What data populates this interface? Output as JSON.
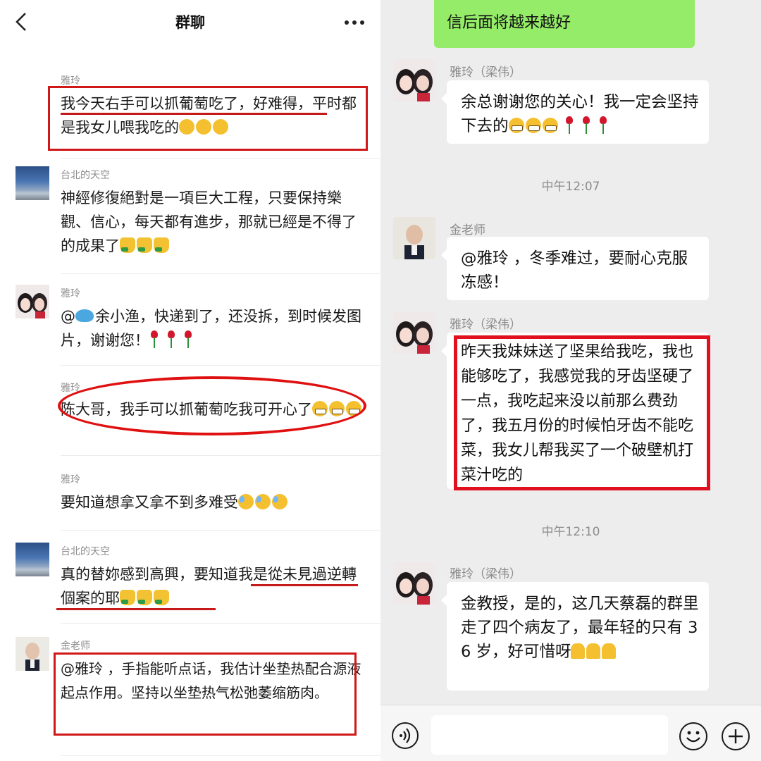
{
  "left_panel": {
    "header": {
      "title": "群聊"
    },
    "posts": [
      {
        "author": "雅玲",
        "text": "我今天右手可以抓葡萄吃了，好难得，平时都是我女儿喂我吃的",
        "emojis": [
          "cover-face",
          "cover-face",
          "cover-face"
        ]
      },
      {
        "author": "台北的天空",
        "text": "神經修復絕對是一項巨大工程，只要保持樂觀、信心，每天都有進步，那就已經是不得了的成果了",
        "emojis": [
          "thumbs-up",
          "thumbs-up",
          "thumbs-up"
        ]
      },
      {
        "author": "雅玲",
        "mention": "@",
        "mention_name": "余小渔",
        "text": "，快递到了，还没拆，到时候发图片，谢谢您！",
        "emojis": [
          "rose",
          "rose",
          "rose"
        ]
      },
      {
        "author": "雅玲",
        "text": "陈大哥，我手可以抓葡萄吃我可开心了",
        "emojis": [
          "grin",
          "grin",
          "grin"
        ]
      },
      {
        "author": "雅玲",
        "text": "要知道想拿又拿不到多难受",
        "emojis": [
          "sweat",
          "sweat",
          "sweat"
        ]
      },
      {
        "author": "台北的天空",
        "text": "真的替妳感到高興，要知道我是從未見過逆轉個案的耶",
        "emojis": [
          "thumbs-up",
          "thumbs-up",
          "thumbs-up"
        ]
      },
      {
        "author": "金老师",
        "text": "@雅玲 ，手指能听点话，我估计坐垫热配合源液起点作用。坚持以坐垫热气松弛萎缩筋肉。",
        "emojis": []
      }
    ]
  },
  "right_panel": {
    "top_green_bubble": {
      "text": "信后面将越来越好"
    },
    "messages": [
      {
        "sender": "雅玲（梁伟）",
        "text": "余总谢谢您的关心！我一定会坚持下去的",
        "emojis": [
          "grin",
          "grin",
          "grin",
          "rose",
          "rose",
          "rose"
        ]
      },
      {
        "sender": "金老师",
        "text": "@雅玲 ，冬季难过，要耐心克服冻感！",
        "emojis": []
      },
      {
        "sender": "雅玲（梁伟）",
        "text": "昨天我妹妹送了坚果给我吃，我也能够吃了，我感觉我的牙齿坚硬了一点，我吃起来没以前那么费劲了，我五月份的时候怕牙齿不能吃菜，我女儿帮我买了一个破壁机打菜汁吃的",
        "emojis": []
      },
      {
        "sender": "雅玲（梁伟）",
        "text": "金教授，是的，这几天蔡磊的群里走了四个病友了，最年轻的只有 36 岁，好可惜呀",
        "emojis": [
          "pray",
          "pray",
          "pray"
        ]
      }
    ],
    "timestamps": {
      "t1": "中午12:07",
      "t2": "中午12:10"
    },
    "input": {
      "value": "",
      "placeholder": ""
    }
  }
}
